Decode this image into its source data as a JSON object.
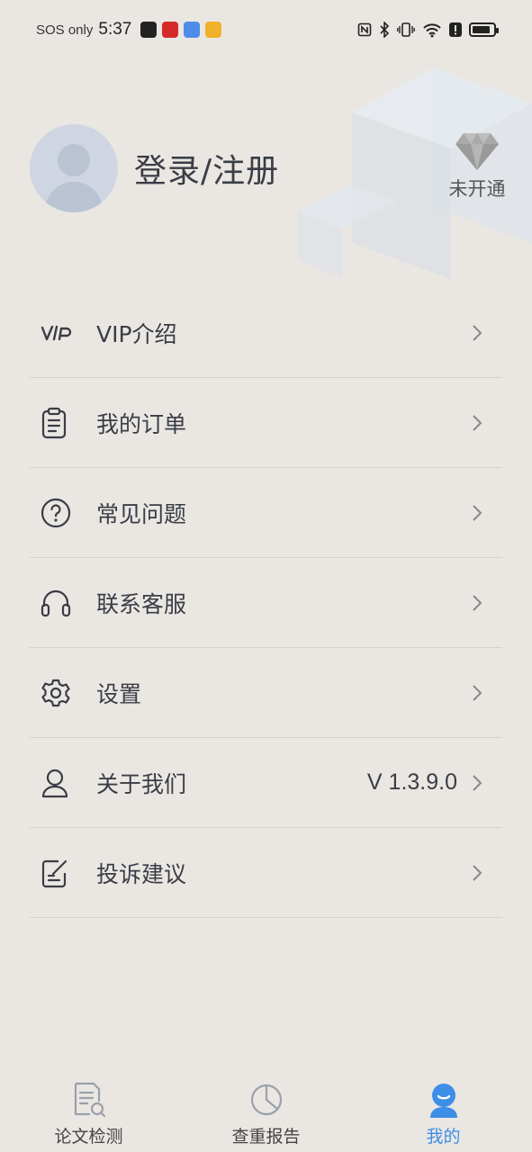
{
  "status_bar": {
    "carrier": "SOS only",
    "time": "5:37"
  },
  "profile": {
    "login_label": "登录/注册",
    "vip_status": "未开通"
  },
  "menu": [
    {
      "icon": "vip-icon",
      "label": "VIP介绍",
      "value": ""
    },
    {
      "icon": "clipboard-icon",
      "label": "我的订单",
      "value": ""
    },
    {
      "icon": "question-icon",
      "label": "常见问题",
      "value": ""
    },
    {
      "icon": "headset-icon",
      "label": "联系客服",
      "value": ""
    },
    {
      "icon": "gear-icon",
      "label": "设置",
      "value": ""
    },
    {
      "icon": "person-icon",
      "label": "关于我们",
      "value": "V 1.3.9.0"
    },
    {
      "icon": "edit-icon",
      "label": "投诉建议",
      "value": ""
    }
  ],
  "bottom_nav": [
    {
      "icon": "document-search-icon",
      "label": "论文检测",
      "active": false
    },
    {
      "icon": "pie-chart-icon",
      "label": "查重报告",
      "active": false
    },
    {
      "icon": "user-icon",
      "label": "我的",
      "active": true
    }
  ],
  "colors": {
    "background": "#eae7e3",
    "accent": "#3d8ee6",
    "text": "#3a3d45"
  }
}
